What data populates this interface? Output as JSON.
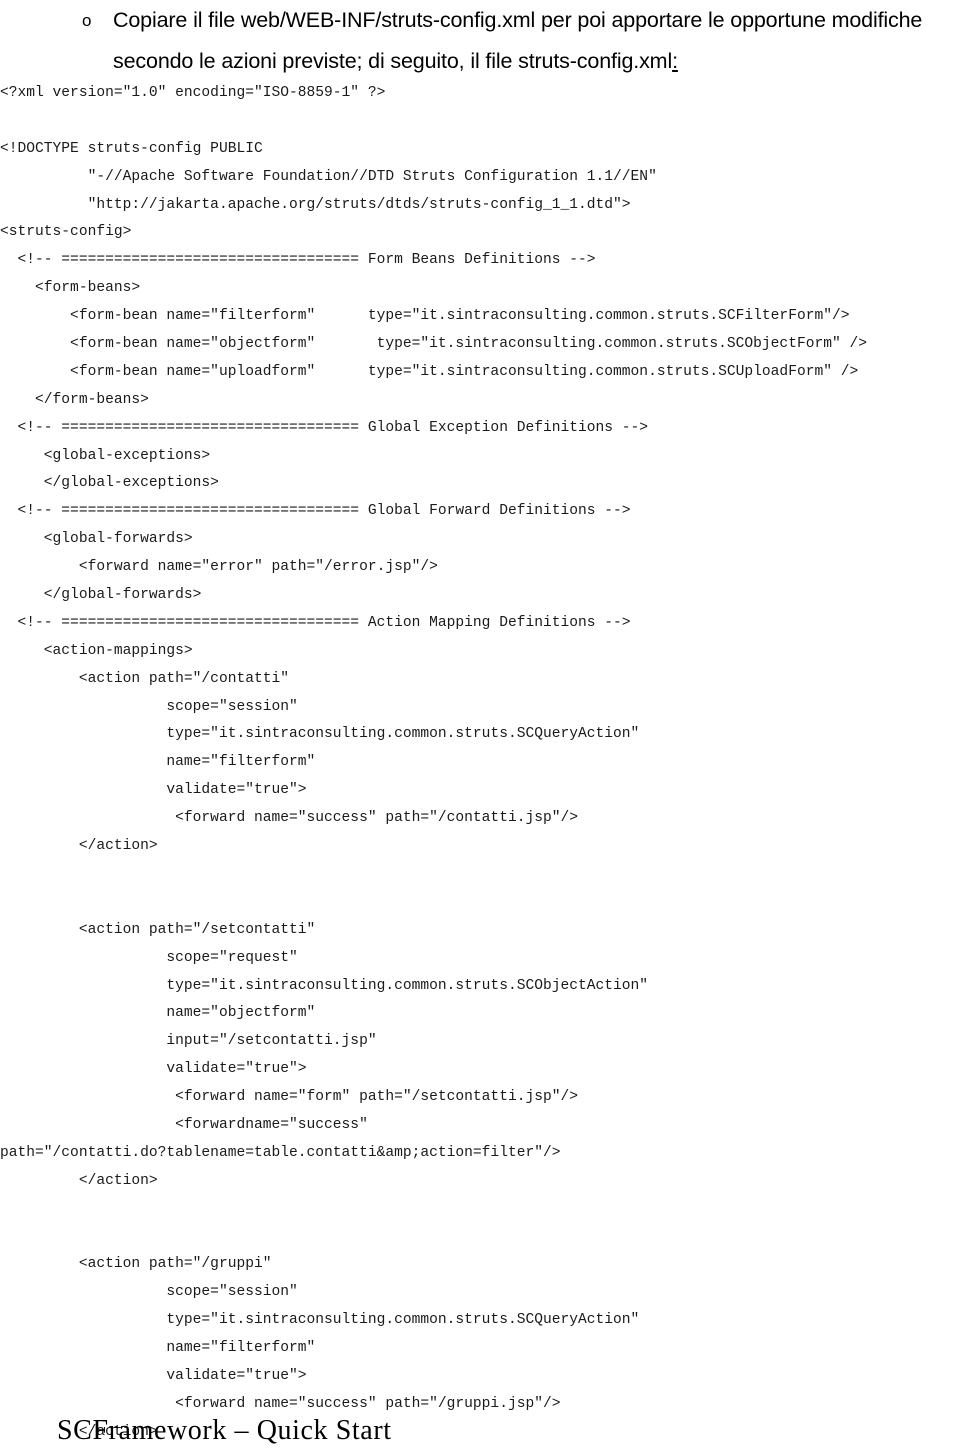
{
  "heading": {
    "bullet_glyph": "o",
    "line1": "Copiare il file web/WEB-INF/struts-config.xml per poi apportare le opportune modifiche",
    "line2_before": "secondo le azioni previste; di seguito, il file struts-config.xml",
    "line2_colon": ":"
  },
  "code": {
    "language": "xml",
    "lines": [
      "<?xml version=\"1.0\" encoding=\"ISO-8859-1\" ?>",
      "",
      "<!DOCTYPE struts-config PUBLIC",
      "          \"-//Apache Software Foundation//DTD Struts Configuration 1.1//EN\"",
      "          \"http://jakarta.apache.org/struts/dtds/struts-config_1_1.dtd\">",
      "<struts-config>",
      "  <!-- ================================== Form Beans Definitions -->",
      "    <form-beans>",
      "        <form-bean name=\"filterform\"      type=\"it.sintraconsulting.common.struts.SCFilterForm\"/>",
      "        <form-bean name=\"objectform\"       type=\"it.sintraconsulting.common.struts.SCObjectForm\" />",
      "        <form-bean name=\"uploadform\"      type=\"it.sintraconsulting.common.struts.SCUploadForm\" />",
      "    </form-beans>",
      "  <!-- ================================== Global Exception Definitions -->",
      "     <global-exceptions>",
      "     </global-exceptions>",
      "  <!-- ================================== Global Forward Definitions -->",
      "     <global-forwards>",
      "         <forward name=\"error\" path=\"/error.jsp\"/>",
      "     </global-forwards>",
      "  <!-- ================================== Action Mapping Definitions -->",
      "     <action-mappings>",
      "         <action path=\"/contatti\"",
      "                   scope=\"session\"",
      "                   type=\"it.sintraconsulting.common.struts.SCQueryAction\"",
      "                   name=\"filterform\"",
      "                   validate=\"true\">",
      "                    <forward name=\"success\" path=\"/contatti.jsp\"/>",
      "         </action>",
      "",
      "",
      "         <action path=\"/setcontatti\"",
      "                   scope=\"request\"",
      "                   type=\"it.sintraconsulting.common.struts.SCObjectAction\"",
      "                   name=\"objectform\"",
      "                   input=\"/setcontatti.jsp\"",
      "                   validate=\"true\">",
      "                    <forward name=\"form\" path=\"/setcontatti.jsp\"/>",
      "                    <forwardname=\"success\"",
      "path=\"/contatti.do?tablename=table.contatti&amp;action=filter\"/>",
      "         </action>",
      "",
      "",
      "         <action path=\"/gruppi\"",
      "                   scope=\"session\"",
      "                   type=\"it.sintraconsulting.common.struts.SCQueryAction\"",
      "                   name=\"filterform\"",
      "                   validate=\"true\">",
      "                    <forward name=\"success\" path=\"/gruppi.jsp\"/>",
      "         </action>"
    ]
  },
  "footer": {
    "text": "SCFramework – Quick Start"
  },
  "colors": {
    "page_background": "#ffffff",
    "body_text": "#000000",
    "code_text": "#1a1a1a"
  }
}
